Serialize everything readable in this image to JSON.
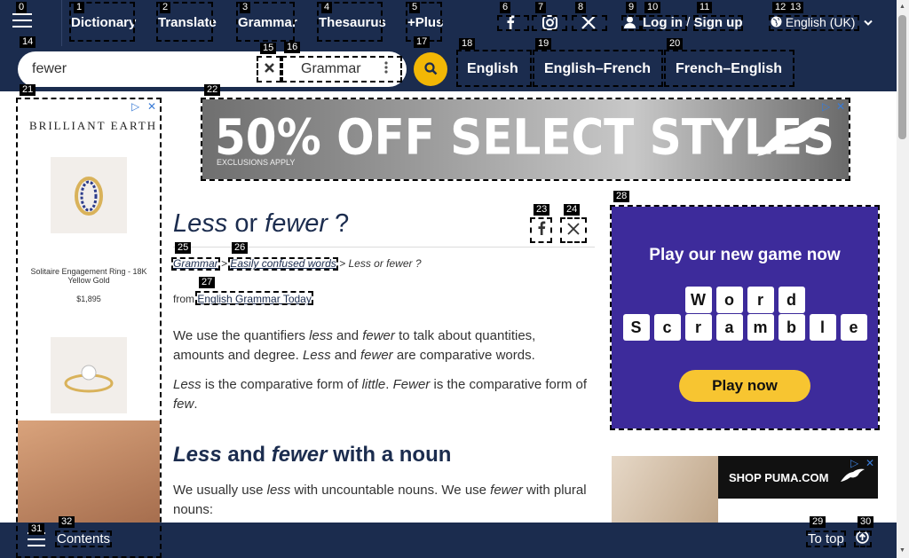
{
  "topnav": {
    "links": [
      "Dictionary",
      "Translate",
      "Grammar",
      "Thesaurus",
      "+Plus"
    ],
    "login": "Log in",
    "login_sep": "/",
    "signup": "Sign up",
    "language": "English (UK)"
  },
  "search": {
    "value": "fewer",
    "dictionary": "Grammar"
  },
  "dict_tabs": [
    "English",
    "English–French",
    "French–English"
  ],
  "ads": {
    "left_brand": "BRILLIANT EARTH",
    "left_ring_caption": "Solitaire Engagement Ring - 18K Yellow Gold",
    "left_ring_price": "$1,895",
    "top_headline": "50% OFF SELECT STYLES",
    "top_note": "EXCLUSIONS APPLY",
    "right_headline": "Play our new game now",
    "right_word1": "Word",
    "right_word2": "Scramble",
    "right_button": "Play now",
    "puma_text": "SHOP PUMA.COM"
  },
  "article": {
    "title_part1": "Less",
    "title_part2": " or ",
    "title_part3": "fewer",
    "title_part4": " ?",
    "crumb1": "Grammar",
    "crumb2": "Easily confused words",
    "crumb3": "Less or fewer ?",
    "crumb_sep": ">",
    "from_label": "from",
    "from_link": "English Grammar Today",
    "p1": {
      "a": "We use the quantifiers ",
      "b": "less",
      "c": " and ",
      "d": "fewer",
      "e": " to talk about quantities, amounts and degree. ",
      "f": "Less",
      "g": " and ",
      "h": "fewer",
      "i": " are comparative words."
    },
    "p2": {
      "a": "Less",
      "b": " is the comparative form of ",
      "c": "little",
      "d": ". ",
      "e": "Fewer",
      "f": " is the comparative form of ",
      "g": "few",
      "h": "."
    },
    "h2": {
      "a": "Less",
      "b": " and ",
      "c": "fewer",
      "d": " with a noun"
    },
    "p3": {
      "a": "We usually use ",
      "b": "less",
      "c": " with uncountable nouns. We use ",
      "d": "fewer",
      "e": " with plural nouns:"
    }
  },
  "bottom": {
    "contents": "Contents",
    "totop": "To top"
  },
  "markers": [
    "0",
    "1",
    "2",
    "3",
    "4",
    "5",
    "6",
    "7",
    "8",
    "9",
    "10",
    "11",
    "12",
    "13",
    "14",
    "15",
    "16",
    "17",
    "18",
    "19",
    "20",
    "21",
    "22",
    "23",
    "24",
    "25",
    "26",
    "27",
    "28",
    "29",
    "30",
    "31",
    "32"
  ],
  "colors": {
    "nav_bg": "#1b2c4e",
    "accent": "#f2b705"
  }
}
